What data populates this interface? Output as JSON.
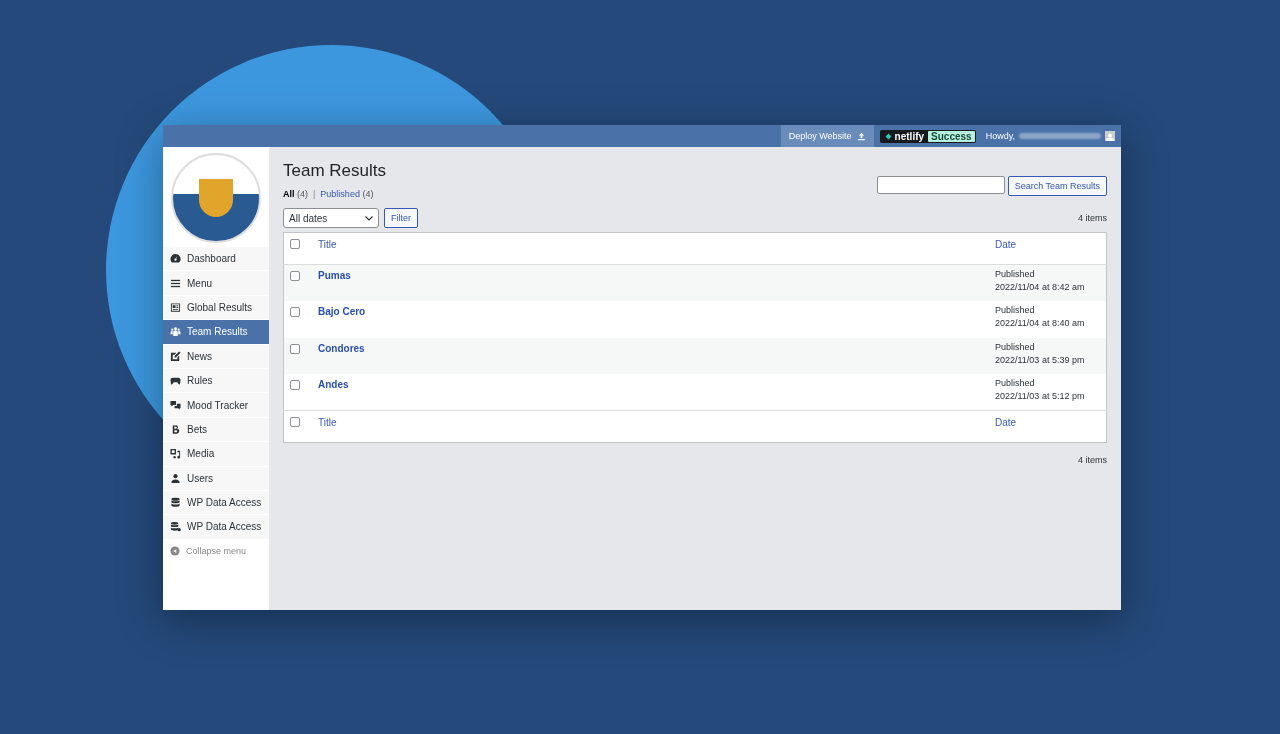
{
  "topbar": {
    "deploy_button": "Deploy Website",
    "netlify_badge": {
      "brand": "netlify",
      "status": "Success"
    },
    "greeting": "Howdy,"
  },
  "sidebar": {
    "items": [
      {
        "label": "Dashboard",
        "selected": false
      },
      {
        "label": "Menu",
        "selected": false
      },
      {
        "label": "Global Results",
        "selected": false
      },
      {
        "label": "Team Results",
        "selected": true
      },
      {
        "label": "News",
        "selected": false
      },
      {
        "label": "Rules",
        "selected": false
      },
      {
        "label": "Mood Tracker",
        "selected": false
      },
      {
        "label": "Bets",
        "selected": false
      },
      {
        "label": "Media",
        "selected": false
      },
      {
        "label": "Users",
        "selected": false
      },
      {
        "label": "WP Data Access",
        "selected": false
      },
      {
        "label": "WP Data Access",
        "selected": false
      }
    ],
    "collapse": "Collapse menu"
  },
  "page": {
    "title": "Team Results",
    "view_separator": "|",
    "views": [
      {
        "label": "All",
        "count": "(4)",
        "selected": true
      },
      {
        "label": "Published",
        "count": "(4)",
        "selected": false
      }
    ],
    "search_button": "Search Team Results",
    "date_filter": "All dates",
    "filter_button": "Filter",
    "items_count_top": "4 items",
    "items_count_bottom": "4 items"
  },
  "table": {
    "columns": [
      "Title",
      "Date"
    ],
    "footer_columns": [
      "Title",
      "Date"
    ],
    "header_checked": false,
    "footer_checked": false,
    "rows": [
      {
        "title": "Pumas",
        "status": "Published",
        "date": "2022/11/04 at 8:42 am",
        "checked": false
      },
      {
        "title": "Bajo Cero",
        "status": "Published",
        "date": "2022/11/04 at 8:40 am",
        "checked": false
      },
      {
        "title": "Condores",
        "status": "Published",
        "date": "2022/11/03 at 5:39 pm",
        "checked": false
      },
      {
        "title": "Andes",
        "status": "Published",
        "date": "2022/11/03 at 5:12 pm",
        "checked": false
      }
    ]
  }
}
